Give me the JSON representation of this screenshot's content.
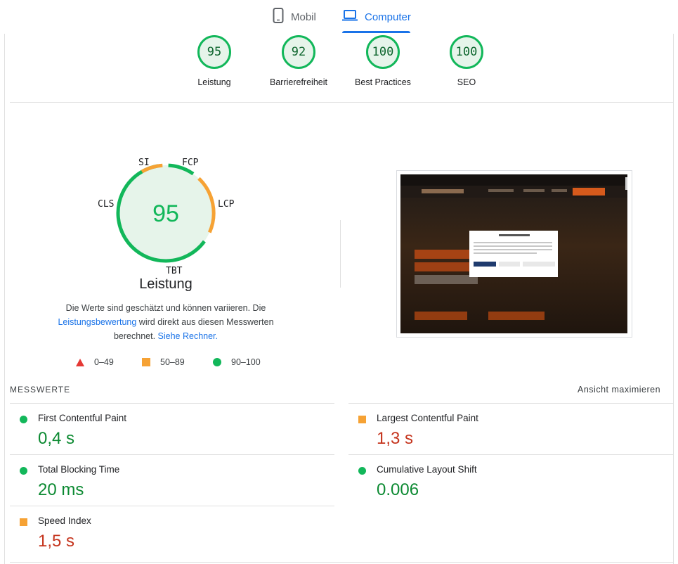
{
  "tabs": {
    "mobile": "Mobil",
    "desktop": "Computer"
  },
  "categories": [
    {
      "score": "95",
      "label": "Leistung"
    },
    {
      "score": "92",
      "label": "Barrierefreiheit"
    },
    {
      "score": "100",
      "label": "Best Practices"
    },
    {
      "score": "100",
      "label": "SEO"
    }
  ],
  "performance": {
    "score": "95",
    "title": "Leistung",
    "gauge_labels": {
      "si": "SI",
      "fcp": "FCP",
      "lcp": "LCP",
      "tbt": "TBT",
      "cls": "CLS"
    },
    "description_1": "Die Werte sind geschätzt und können variieren. Die",
    "link_rating": "Leistungsbewertung",
    "description_2": " wird direkt aus diesen Messwerten berechnet.",
    "link_calculator": "Siehe Rechner."
  },
  "legend": {
    "poor": "0–49",
    "average": "50–89",
    "good": "90–100"
  },
  "metrics_section": {
    "title": "MESSWERTE",
    "expand_label": "Ansicht maximieren"
  },
  "metrics": [
    {
      "name": "First Contentful Paint",
      "value": "0,4 s",
      "status": "good"
    },
    {
      "name": "Largest Contentful Paint",
      "value": "1,3 s",
      "status": "average"
    },
    {
      "name": "Total Blocking Time",
      "value": "20 ms",
      "status": "good"
    },
    {
      "name": "Cumulative Layout Shift",
      "value": "0.006",
      "status": "good"
    },
    {
      "name": "Speed Index",
      "value": "1,5 s",
      "status": "average"
    }
  ],
  "colors": {
    "good": "#12b75a",
    "average": "#f6a234",
    "poor": "#e53935",
    "accent": "#1a73e8"
  }
}
